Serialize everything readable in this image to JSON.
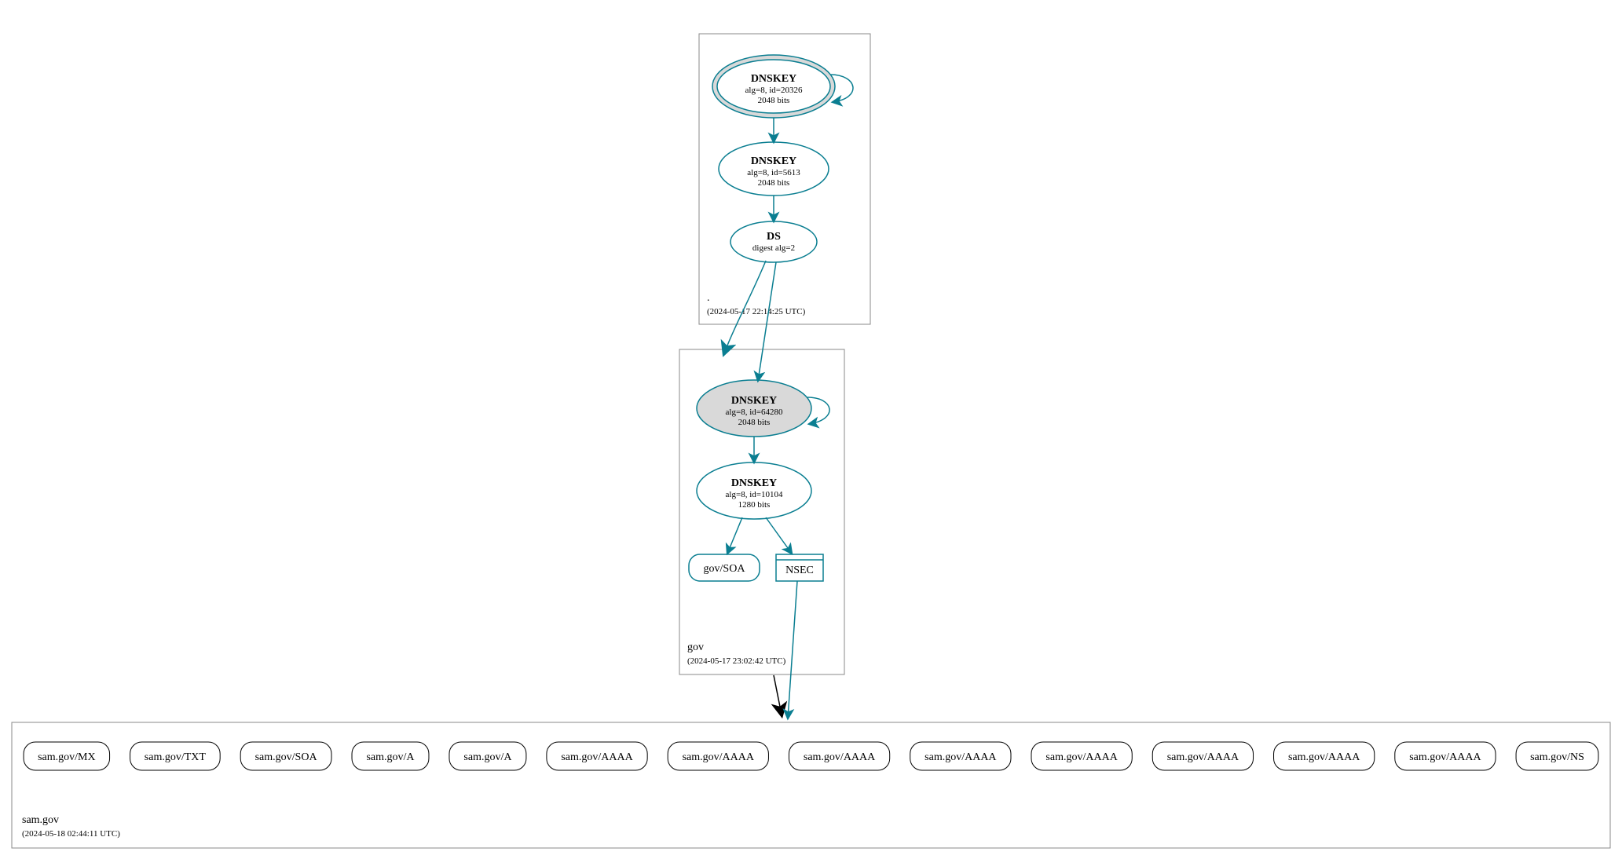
{
  "colors": {
    "teal": "#0a7e91",
    "grayFill": "#d9d9d9",
    "grayStroke": "#888888"
  },
  "zones": {
    "root": {
      "name": ".",
      "date": "(2024-05-17 22:14:25 UTC)"
    },
    "gov": {
      "name": "gov",
      "date": "(2024-05-17 23:02:42 UTC)"
    },
    "sam": {
      "name": "sam.gov",
      "date": "(2024-05-18 02:44:11 UTC)"
    }
  },
  "nodes": {
    "rootKSK": {
      "l1": "DNSKEY",
      "l2": "alg=8, id=20326",
      "l3": "2048 bits"
    },
    "rootZSK": {
      "l1": "DNSKEY",
      "l2": "alg=8, id=5613",
      "l3": "2048 bits"
    },
    "rootDS": {
      "l1": "DS",
      "l2": "digest alg=2"
    },
    "govKSK": {
      "l1": "DNSKEY",
      "l2": "alg=8, id=64280",
      "l3": "2048 bits"
    },
    "govZSK": {
      "l1": "DNSKEY",
      "l2": "alg=8, id=10104",
      "l3": "1280 bits"
    },
    "govSOA": {
      "label": "gov/SOA"
    },
    "govNSEC": {
      "label": "NSEC"
    },
    "leaves": [
      "sam.gov/MX",
      "sam.gov/TXT",
      "sam.gov/SOA",
      "sam.gov/A",
      "sam.gov/A",
      "sam.gov/AAAA",
      "sam.gov/AAAA",
      "sam.gov/AAAA",
      "sam.gov/AAAA",
      "sam.gov/AAAA",
      "sam.gov/AAAA",
      "sam.gov/AAAA",
      "sam.gov/AAAA",
      "sam.gov/NS"
    ]
  }
}
